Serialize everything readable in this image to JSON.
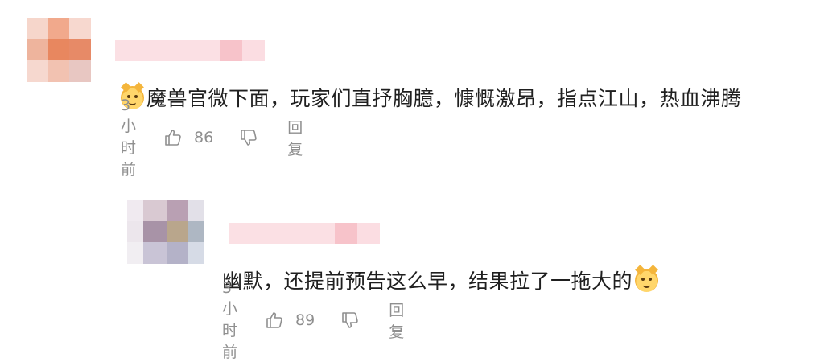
{
  "comments": [
    {
      "text": "魔兽官微下面，玩家们直抒胸臆，慷慨激昂，指点江山，热血沸腾",
      "emoji_position": "start",
      "emoji_icon": "cat-face-icon",
      "time": "3小时前",
      "likes": "86",
      "reply_label": "回复"
    },
    {
      "text": "幽默，还提前预告这么早，结果拉了一拖大的",
      "emoji_position": "end",
      "emoji_icon": "cat-face-icon",
      "time": "3小时前",
      "likes": "89",
      "reply_label": "回复"
    }
  ],
  "colors": {
    "text": "#1f1f1f",
    "meta": "#8f8f8f",
    "name_blur": "#f9c8cf",
    "avatar1": [
      "#f6d6cb",
      "#f1a98c",
      "#f7d8cf",
      "#eeb49d",
      "#e8875f",
      "#e78a67",
      "#f6d8cf",
      "#f2c2b1",
      "#e8c7c2"
    ],
    "avatar2": [
      "#d9c9d2",
      "#b9a0b3",
      "#d4d0d8",
      "#a893a7",
      "#b9a68c",
      "#aeb7c3",
      "#c9c4d6",
      "#b4b2c8",
      "#d6dbe6"
    ]
  }
}
